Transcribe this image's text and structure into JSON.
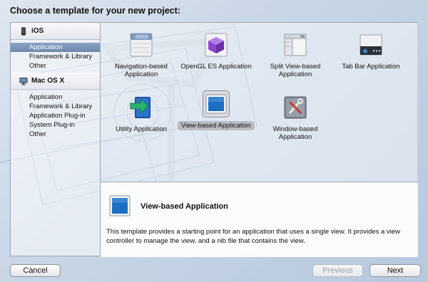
{
  "dialog": {
    "title": "Choose a template for your new project:"
  },
  "sidebar": {
    "sections": [
      {
        "header": "iOS",
        "items": [
          "Application",
          "Framework & Library",
          "Other"
        ],
        "selected_index": 0
      },
      {
        "header": "Mac OS X",
        "items": [
          "Application",
          "Framework & Library",
          "Application Plug-in",
          "System Plug-in",
          "Other"
        ],
        "selected_index": -1
      }
    ]
  },
  "templates": [
    {
      "label": "Navigation-based Application",
      "icon": "navigation-app-icon"
    },
    {
      "label": "OpenGL ES Application",
      "icon": "opengl-cube-icon"
    },
    {
      "label": "Split View-based Application",
      "icon": "split-view-icon"
    },
    {
      "label": "Tab Bar Application",
      "icon": "tab-bar-icon"
    },
    {
      "label": "Utility Application",
      "icon": "utility-arrow-icon"
    },
    {
      "label": "View-based Application",
      "icon": "view-app-icon",
      "selected": true
    },
    {
      "label": "Window-based Application",
      "icon": "window-tools-icon"
    }
  ],
  "detail": {
    "title": "View-based Application",
    "description": "This template provides a starting point for an application that uses a single view. It provides a view controller to manage the view, and a nib file that contains the view."
  },
  "buttons": {
    "cancel": "Cancel",
    "previous": "Previous",
    "next": "Next"
  },
  "colors": {
    "selection": "#7891b5",
    "view_icon_blue": "#1a6fc4"
  }
}
